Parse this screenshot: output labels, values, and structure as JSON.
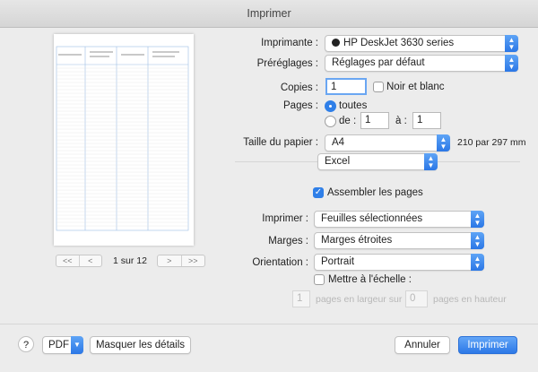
{
  "window": {
    "title": "Imprimer"
  },
  "preview": {
    "page_indicator": "1 sur 12",
    "nav_first": "<<",
    "nav_prev": "<",
    "nav_next": ">",
    "nav_last": ">>"
  },
  "printer": {
    "label": "Imprimante :",
    "value": "HP DeskJet 3630 series"
  },
  "presets": {
    "label": "Préréglages :",
    "value": "Réglages par défaut"
  },
  "copies": {
    "label": "Copies :",
    "value": "1",
    "bw_label": "Noir et blanc",
    "bw_checked": false
  },
  "pages": {
    "label": "Pages :",
    "all_label": "toutes",
    "from_label": "de :",
    "from_value": "1",
    "to_label": "à :",
    "to_value": "1"
  },
  "paper": {
    "label": "Taille du papier :",
    "value": "A4",
    "dimensions": "210 par 297 mm"
  },
  "app_menu": {
    "value": "Excel"
  },
  "collate": {
    "label": "Assembler les pages",
    "checked": true
  },
  "print_what": {
    "label": "Imprimer :",
    "value": "Feuilles sélectionnées"
  },
  "margins": {
    "label": "Marges :",
    "value": "Marges étroites"
  },
  "orientation": {
    "label": "Orientation :",
    "value": "Portrait"
  },
  "scale": {
    "label": "Mettre à l'échelle :",
    "checked": false,
    "width_value": "1",
    "width_label": "pages en largeur sur",
    "height_value": "0",
    "height_label": "pages en hauteur"
  },
  "footer": {
    "help": "?",
    "pdf_label": "PDF",
    "details_label": "Masquer les détails",
    "cancel_label": "Annuler",
    "print_label": "Imprimer"
  }
}
